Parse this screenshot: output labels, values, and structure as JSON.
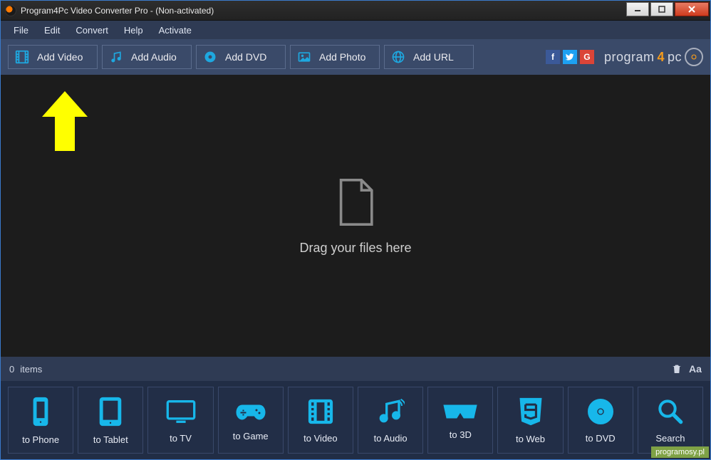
{
  "title": "Program4Pc Video Converter Pro - (Non-activated)",
  "menu": {
    "file": "File",
    "edit": "Edit",
    "convert": "Convert",
    "help": "Help",
    "activate": "Activate"
  },
  "toolbar": {
    "add_video": "Add Video",
    "add_audio": "Add Audio",
    "add_dvd": "Add DVD",
    "add_photo": "Add Photo",
    "add_url": "Add URL"
  },
  "brand": {
    "text_a": "program",
    "text_b": "4",
    "text_c": "pc"
  },
  "drop": {
    "text": "Drag your files here"
  },
  "status": {
    "items_count": "0",
    "items_label": "items",
    "rename_label": "Aa"
  },
  "presets": {
    "phone": "to Phone",
    "tablet": "to Tablet",
    "tv": "to TV",
    "game": "to Game",
    "video": "to Video",
    "audio": "to Audio",
    "threeD": "to 3D",
    "web": "to Web",
    "dvd": "to DVD",
    "search": "Search"
  },
  "watermark": "programosy.pl"
}
